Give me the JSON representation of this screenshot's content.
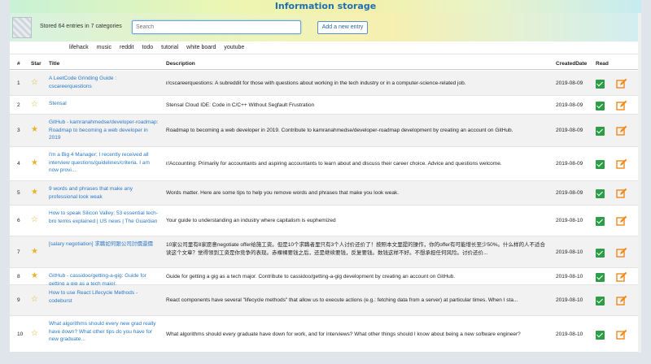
{
  "app": {
    "title": "Information storage",
    "stored_text": "Stored 64 entries in 7 categories",
    "search_placeholder": "Search",
    "add_button": "Add a new entry"
  },
  "tags": [
    "lifehack",
    "music",
    "reddit",
    "todo",
    "tutorial",
    "white board",
    "youtube"
  ],
  "columns": {
    "num": "#",
    "star": "Star",
    "title": "Title",
    "description": "Description",
    "created": "CreatedDate",
    "read": "Read"
  },
  "rows": [
    {
      "num": "1",
      "starred": false,
      "title": "A LeetCode Grinding Guide : cscareerquestions",
      "description": "r/cscareerquestions: A subreddit for those with questions about working in the tech industry or in a computer-science-related job.",
      "date": "2019-08-09"
    },
    {
      "num": "2",
      "starred": false,
      "title": "Stensal",
      "description": "Stensal Cloud IDE: Code in C/C++ Without Segfault Frustration",
      "date": "2019-08-09"
    },
    {
      "num": "3",
      "starred": true,
      "title": "GitHub - kamranahmedse/developer-roadmap: Roadmap to becoming a web developer in 2019",
      "description": "Roadmap to becoming a web developer in 2019. Contribute to kamranahmedse/developer-roadmap development by creating an account on GitHub.",
      "date": "2019-08-09"
    },
    {
      "num": "4",
      "starred": true,
      "title": "I'm a Big 4 Manager; I recently received all interview questions/guidelines/criteria. I am now provi...",
      "description": "r/Accounting: Primarily for accountants and aspiring accountants to learn about and discuss their career choice. Advice and questions welcome.",
      "date": "2019-08-09"
    },
    {
      "num": "5",
      "starred": true,
      "title": "9 words and phrases that make any professional look weak",
      "description": "Words matter. Here are some tips to help you remove words and phrases that make you look weak.",
      "date": "2019-08-09"
    },
    {
      "num": "6",
      "starred": false,
      "title": "How to speak Silicon Valley: 53 essential tech-bro terms explained | US news | The Guardian",
      "description": "Your guide to understanding an industry where capitalism is euphemized",
      "date": "2019-08-10"
    },
    {
      "num": "7",
      "starred": true,
      "title": "[salary negotiation] 求職如何跟公司討價還價",
      "description": "10家公司里有8家愿意negotiate offer给施工资。但是10个求職者里只有3个人讨价还价了！按照本文里提的操作，你的offer有可能增长至少50%。什么样的人不适合读这个文章？觉得领到工资是你竞争的表现。赤裸裸要钱之后，还是继续要钱，反复要钱。数钱这样不好。不想承担任何风险。讨价还价...",
      "date": "2019-08-10"
    },
    {
      "num": "8",
      "starred": true,
      "title": "GitHub - cassidoo/getting-a-gig: Guide for getting a gig as a tech major.",
      "description": "Guide for getting a gig as a tech major. Contribute to cassidoo/getting-a-gig development by creating an account on GitHub.",
      "date": "2019-08-10"
    },
    {
      "num": "9",
      "starred": false,
      "title": "How to use React Lifecycle Methods - codeburst",
      "description": "React components have several \"lifecycle methods\" that allow us to execute actions (e.g.: fetching data from a server) at particular times. When I sta...",
      "date": "2019-08-10"
    },
    {
      "num": "10",
      "starred": false,
      "title": "What algorithms should every new grad really have down? What other tips do you have for new graduate...",
      "description": "What algorithms should every graduate have down for work, and for interviews? What other things should I know about being a new software engineer?",
      "date": "2019-08-10"
    }
  ],
  "colors": {
    "accent": "#2b78c6",
    "star": "#e8b32a",
    "read_check": "#2e9d48",
    "edit": "#f08a1c"
  },
  "icons": {
    "star_filled": "star-filled-icon",
    "star_outline": "star-outline-icon",
    "read": "checkbox-checked-icon",
    "edit": "edit-icon"
  }
}
